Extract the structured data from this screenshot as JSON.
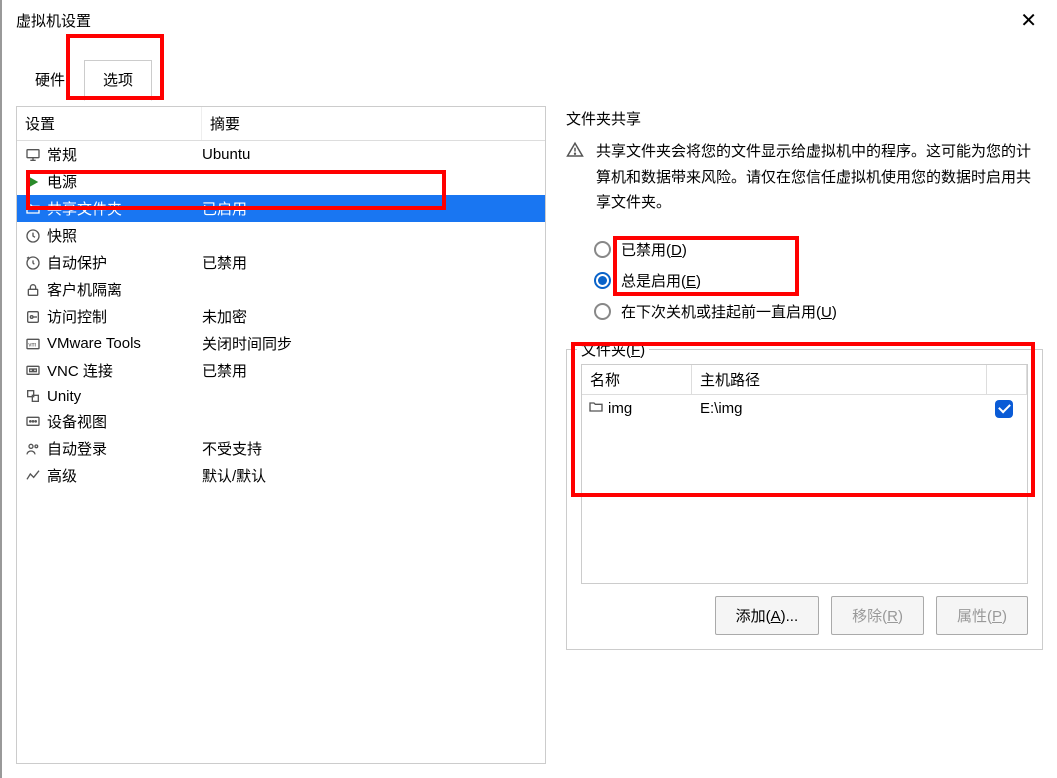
{
  "window": {
    "title": "虚拟机设置",
    "close_label": "✕"
  },
  "tabs": {
    "hardware": "硬件",
    "options": "选项",
    "active": "options"
  },
  "list": {
    "header_setting": "设置",
    "header_summary": "摘要",
    "rows": [
      {
        "icon": "monitor",
        "label": "常规",
        "summary": "Ubuntu"
      },
      {
        "icon": "play",
        "label": "电源",
        "summary": ""
      },
      {
        "icon": "folder-share",
        "label": "共享文件夹",
        "summary": "已启用",
        "selected": true
      },
      {
        "icon": "clock",
        "label": "快照",
        "summary": ""
      },
      {
        "icon": "shield-clock",
        "label": "自动保护",
        "summary": "已禁用"
      },
      {
        "icon": "lock",
        "label": "客户机隔离",
        "summary": ""
      },
      {
        "icon": "key",
        "label": "访问控制",
        "summary": "未加密"
      },
      {
        "icon": "vmw",
        "label": "VMware Tools",
        "summary": "关闭时间同步"
      },
      {
        "icon": "vnc",
        "label": "VNC 连接",
        "summary": "已禁用"
      },
      {
        "icon": "unity",
        "label": "Unity",
        "summary": ""
      },
      {
        "icon": "device",
        "label": "设备视图",
        "summary": ""
      },
      {
        "icon": "autologin",
        "label": "自动登录",
        "summary": "不受支持"
      },
      {
        "icon": "advanced",
        "label": "高级",
        "summary": "默认/默认"
      }
    ]
  },
  "right": {
    "section_title": "文件夹共享",
    "warning_text": "共享文件夹会将您的文件显示给虚拟机中的程序。这可能为您的计算机和数据带来风险。请仅在您信任虚拟机使用您的数据时启用共享文件夹。",
    "radios": {
      "disabled_pre": "已禁用(",
      "disabled_hk": "D",
      "disabled_post": ")",
      "always_pre": "总是启用(",
      "always_hk": "E",
      "always_post": ")",
      "until_pre": "在下次关机或挂起前一直启用(",
      "until_hk": "U",
      "until_post": ")",
      "selected": "always"
    },
    "folders": {
      "legend_pre": "文件夹(",
      "legend_hk": "F",
      "legend_post": ")",
      "header_name": "名称",
      "header_path": "主机路径",
      "rows": [
        {
          "name": "img",
          "path": "E:\\img",
          "checked": true
        }
      ]
    },
    "buttons": {
      "add_pre": "添加(",
      "add_hk": "A",
      "add_post": ")...",
      "remove_pre": "移除(",
      "remove_hk": "R",
      "remove_post": ")",
      "props_pre": "属性(",
      "props_hk": "P",
      "props_post": ")"
    }
  }
}
